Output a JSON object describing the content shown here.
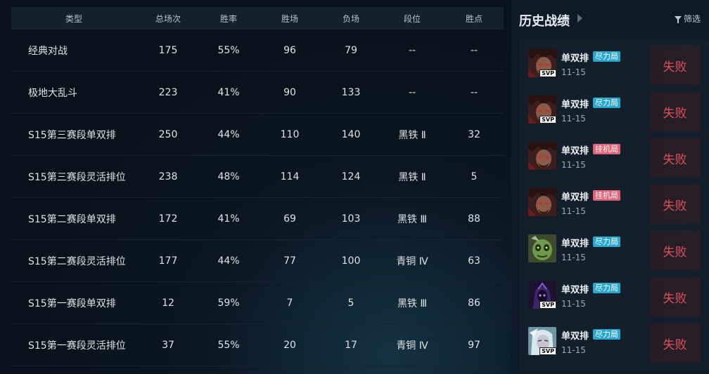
{
  "table": {
    "headers": {
      "type": "类型",
      "total": "总场次",
      "rate": "胜率",
      "win": "胜场",
      "loss": "负场",
      "rank": "段位",
      "lp": "胜点"
    },
    "rows": [
      {
        "type": "经典对战",
        "total": "175",
        "rate": "55%",
        "win": "96",
        "loss": "79",
        "rank": "--",
        "lp": "--"
      },
      {
        "type": "极地大乱斗",
        "total": "223",
        "rate": "41%",
        "win": "90",
        "loss": "133",
        "rank": "--",
        "lp": "--"
      },
      {
        "type": "S15第三赛段单双排",
        "total": "250",
        "rate": "44%",
        "win": "110",
        "loss": "140",
        "rank": "黑铁 Ⅱ",
        "lp": "32"
      },
      {
        "type": "S15第三赛段灵活排位",
        "total": "238",
        "rate": "48%",
        "win": "114",
        "loss": "124",
        "rank": "黑铁 Ⅱ",
        "lp": "5"
      },
      {
        "type": "S15第二赛段单双排",
        "total": "172",
        "rate": "41%",
        "win": "69",
        "loss": "103",
        "rank": "黑铁 Ⅲ",
        "lp": "88"
      },
      {
        "type": "S15第二赛段灵活排位",
        "total": "177",
        "rate": "44%",
        "win": "77",
        "loss": "100",
        "rank": "青铜 Ⅳ",
        "lp": "63"
      },
      {
        "type": "S15第一赛段单双排",
        "total": "12",
        "rate": "59%",
        "win": "7",
        "loss": "5",
        "rank": "黑铁 Ⅲ",
        "lp": "86"
      },
      {
        "type": "S15第一赛段灵活排位",
        "total": "37",
        "rate": "55%",
        "win": "20",
        "loss": "17",
        "rank": "青铜 Ⅳ",
        "lp": "97"
      }
    ]
  },
  "history": {
    "title": "历史战绩",
    "filter_label": "筛选",
    "colors": {
      "loss": "#e0515c",
      "tag_blue": "#2aa7cf",
      "tag_pink": "#e0637a"
    },
    "matches": [
      {
        "champion_icon": "darius-icon",
        "svp": "SVP",
        "mode": "单双排",
        "tag": "尽力局",
        "tag_color": "blue",
        "date": "11-15",
        "result": "失败"
      },
      {
        "champion_icon": "darius-icon",
        "svp": "SVP",
        "mode": "单双排",
        "tag": "尽力局",
        "tag_color": "blue",
        "date": "11-15",
        "result": "失败"
      },
      {
        "champion_icon": "darius-icon",
        "svp": "",
        "mode": "单双排",
        "tag": "挂机局",
        "tag_color": "pink",
        "date": "11-15",
        "result": "失败"
      },
      {
        "champion_icon": "darius-icon",
        "svp": "",
        "mode": "单双排",
        "tag": "挂机局",
        "tag_color": "pink",
        "date": "11-15",
        "result": "失败"
      },
      {
        "champion_icon": "zombie-champion-icon",
        "svp": "",
        "mode": "单双排",
        "tag": "尽力局",
        "tag_color": "blue",
        "date": "11-15",
        "result": "失败"
      },
      {
        "champion_icon": "void-champion-icon",
        "svp": "SVP",
        "mode": "单双排",
        "tag": "尽力局",
        "tag_color": "blue",
        "date": "11-15",
        "result": "失败"
      },
      {
        "champion_icon": "ice-champion-icon",
        "svp": "SVP",
        "mode": "单双排",
        "tag": "尽力局",
        "tag_color": "blue",
        "date": "11-15",
        "result": "失败"
      }
    ]
  }
}
